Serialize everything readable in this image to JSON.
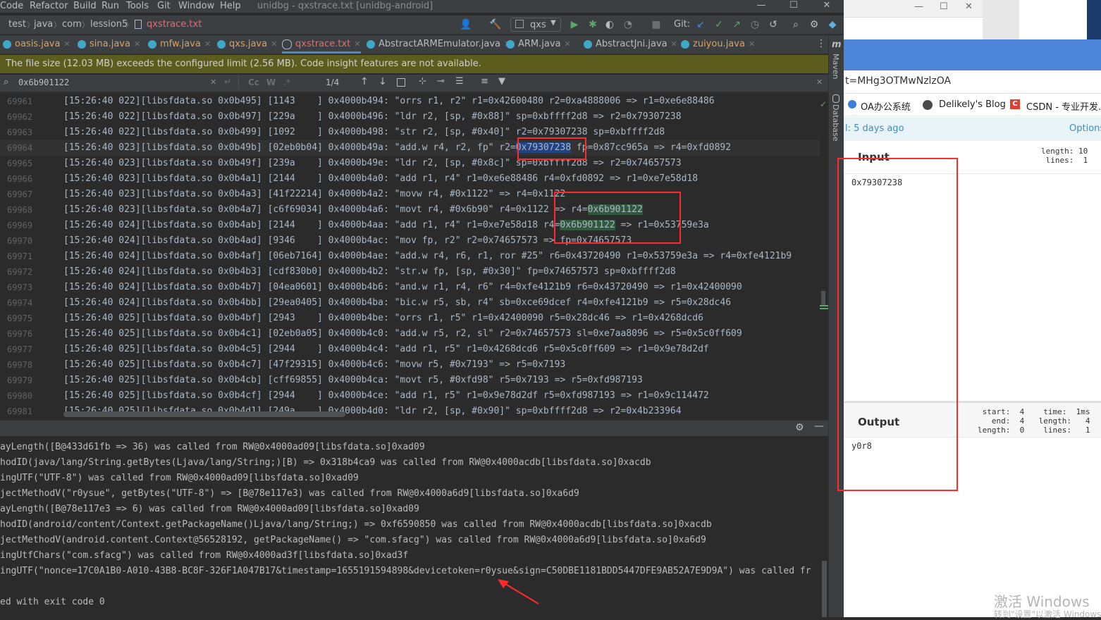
{
  "ide": {
    "menu": [
      "Code",
      "Refactor",
      "Build",
      "Run",
      "Tools",
      "Git",
      "Window",
      "Help"
    ],
    "window_title": "unidbg - qxstrace.txt [unidbg-android]",
    "window_buttons": [
      "—",
      "☐",
      "✕"
    ],
    "breadcrumbs": [
      "test",
      "java",
      "com",
      "lession5",
      "qxstrace.txt"
    ],
    "run_config": "qxs",
    "git_label": "Git:",
    "tabs": [
      {
        "label": "oasis.java",
        "color": "#40a8c7",
        "active": false
      },
      {
        "label": "sina.java",
        "color": "#40a8c7",
        "active": false
      },
      {
        "label": "mfw.java",
        "color": "#40a8c7",
        "active": false
      },
      {
        "label": "qxs.java",
        "color": "#40a8c7",
        "active": false
      },
      {
        "label": "qxstrace.txt",
        "color": "#a9b7c6",
        "active": true
      },
      {
        "label": "AbstractARMEmulator.java",
        "color": "#40a8c7",
        "active": false
      },
      {
        "label": "ARM.java",
        "color": "#40a8c7",
        "active": false
      },
      {
        "label": "AbstractJni.java",
        "color": "#40a8c7",
        "active": false
      },
      {
        "label": "zuiyou.java",
        "color": "#40a8c7",
        "active": false
      }
    ],
    "banner": "The file size (12.03 MB) exceeds the configured limit (2.56 MB). Code insight features are not available.",
    "find": {
      "query": "0x6b901122",
      "count": "1/4",
      "cc": "Cc",
      "w": "W"
    },
    "editor_lines": [
      {
        "num": "69961",
        "text": "[15:26:40 022][libsfdata.so 0x0b495] [1143    ] 0x4000b494: \"orrs r1, r2\" r1=0x42600480 r2=0xa4888006 => r1=0xe6e88486"
      },
      {
        "num": "69962",
        "text": "[15:26:40 022][libsfdata.so 0x0b497] [229a    ] 0x4000b496: \"ldr r2, [sp, #0x88]\" sp=0xbffff2d8 => r2=0x79307238"
      },
      {
        "num": "69963",
        "text": "[15:26:40 022][libsfdata.so 0x0b499] [1092    ] 0x4000b498: \"str r2, [sp, #0x40]\" r2=0x79307238 sp=0xbffff2d8"
      },
      {
        "num": "69964",
        "pre": "[15:26:40 023][libsfdata.so 0x0b49b] [02eb0b04] 0x4000b49a: \"add.w r4, r2, fp\" r2=",
        "sel": "0x79307238",
        "post": " fp=0x87cc965a => r4=0xfd0892"
      },
      {
        "num": "69965",
        "text": "[15:26:40 023][libsfdata.so 0x0b49f] [239a    ] 0x4000b49e: \"ldr r2, [sp, #0x8c]\" sp=0xbffff2d8 => r2=0x74657573"
      },
      {
        "num": "69966",
        "text": "[15:26:40 023][libsfdata.so 0x0b4a1] [2144    ] 0x4000b4a0: \"add r1, r4\" r1=0xe6e88486 r4=0xfd0892 => r1=0xe7e58d18"
      },
      {
        "num": "69967",
        "text": "[15:26:40 023][libsfdata.so 0x0b4a3] [41f22214] 0x4000b4a2: \"movw r4, #0x1122\" => r4=0x1122"
      },
      {
        "num": "69968",
        "pre": "[15:26:40 023][libsfdata.so 0x0b4a7] [c6f69034] 0x4000b4a6: \"movt r4, #0x6b90\" r4=0x1122 => r4=",
        "find": "0x6b901122",
        "post": ""
      },
      {
        "num": "69969",
        "pre": "[15:26:40 024][libsfdata.so 0x0b4ab] [2144    ] 0x4000b4aa: \"add r1, r4\" r1=0xe7e58d18 r4=",
        "find": "0x6b901122",
        "post": " => r1=0x53759e3a"
      },
      {
        "num": "69970",
        "text": "[15:26:40 024][libsfdata.so 0x0b4ad] [9346    ] 0x4000b4ac: \"mov fp, r2\" r2=0x74657573 => fp=0x74657573"
      },
      {
        "num": "69971",
        "text": "[15:26:40 024][libsfdata.so 0x0b4af] [06eb7164] 0x4000b4ae: \"add.w r4, r6, r1, ror #25\" r6=0x43720490 r1=0x53759e3a => r4=0xfe4121b9"
      },
      {
        "num": "69972",
        "text": "[15:26:40 024][libsfdata.so 0x0b4b3] [cdf830b0] 0x4000b4b2: \"str.w fp, [sp, #0x30]\" fp=0x74657573 sp=0xbffff2d8"
      },
      {
        "num": "69973",
        "text": "[15:26:40 024][libsfdata.so 0x0b4b7] [04ea0601] 0x4000b4b6: \"and.w r1, r4, r6\" r4=0xfe4121b9 r6=0x43720490 => r1=0x42400090"
      },
      {
        "num": "69974",
        "text": "[15:26:40 024][libsfdata.so 0x0b4bb] [29ea0405] 0x4000b4ba: \"bic.w r5, sb, r4\" sb=0xce69dcef r4=0xfe4121b9 => r5=0x28dc46"
      },
      {
        "num": "69975",
        "text": "[15:26:40 025][libsfdata.so 0x0b4bf] [2943    ] 0x4000b4be: \"orrs r1, r5\" r1=0x42400090 r5=0x28dc46 => r1=0x4268dcd6"
      },
      {
        "num": "69976",
        "text": "[15:26:40 025][libsfdata.so 0x0b4c1] [02eb0a05] 0x4000b4c0: \"add.w r5, r2, sl\" r2=0x74657573 sl=0xe7aa8096 => r5=0x5c0ff609"
      },
      {
        "num": "69977",
        "text": "[15:26:40 025][libsfdata.so 0x0b4c5] [2944    ] 0x4000b4c4: \"add r1, r5\" r1=0x4268dcd6 r5=0x5c0ff609 => r1=0x9e78d2df"
      },
      {
        "num": "69978",
        "text": "[15:26:40 025][libsfdata.so 0x0b4c7] [47f29315] 0x4000b4c6: \"movw r5, #0x7193\" => r5=0x7193"
      },
      {
        "num": "69979",
        "text": "[15:26:40 025][libsfdata.so 0x0b4cb] [cff69855] 0x4000b4ca: \"movt r5, #0xfd98\" r5=0x7193 => r5=0xfd987193"
      },
      {
        "num": "69980",
        "text": "[15:26:40 025][libsfdata.so 0x0b4cf] [2944    ] 0x4000b4ce: \"add r1, r5\" r1=0x9e78d2df r5=0xfd987193 => r1=0x9c114472"
      },
      {
        "num": "69981",
        "text": "[15:26:40 025][libsfdata.so 0x0b4d1] [249a    ] 0x4000b4d0: \"ldr r2, [sp, #0x90]\" sp=0xbffff2d8 => r2=0x4b233964"
      }
    ],
    "console_lines": [
      "ayLength([B@433d61fb => 36) was called from RW@0x4000ad09[libsfdata.so]0xad09",
      "hodID(java/lang/String.getBytes(Ljava/lang/String;)[B) => 0x318b4ca9 was called from RW@0x4000acdb[libsfdata.so]0xacdb",
      "ingUTF(\"UTF-8\") was called from RW@0x4000ad09[libsfdata.so]0xad09",
      "jectMethodV(\"r0ysue\", getBytes(\"UTF-8\") => [B@78e117e3) was called from RW@0x4000a6d9[libsfdata.so]0xa6d9",
      "ayLength([B@78e117e3 => 6) was called from RW@0x4000ad09[libsfdata.so]0xad09",
      "hodID(android/content/Context.getPackageName()Ljava/lang/String;) => 0xf6590850 was called from RW@0x4000acdb[libsfdata.so]0xacdb",
      "jectMethodV(android.content.Context@56528192, getPackageName() => \"com.sfacg\") was called from RW@0x4000a6d9[libsfdata.so]0xa6d9",
      "ingUtfChars(\"com.sfacg\") was called from RW@0x4000ad3f[libsfdata.so]0xad3f",
      "ingUTF(\"nonce=17C0A1B0-A010-43B8-BC8F-326F1A047B17&timestamp=1655191594898&devicetoken=r0ysue&sign=C50DBE1181BDD5447DFE9AB52A7E9D9A\") was called fr",
      "",
      "ed with exit code 0"
    ],
    "side_tabs": [
      "Maven",
      "Database"
    ]
  },
  "browser": {
    "url": "t=MHg3OTMwNzlzOA",
    "bookmarks": [
      "OA办公系统",
      "Delikely's Blog",
      "CSDN - 专业开发..."
    ],
    "saved": "l: 5 days ago",
    "options": "Options",
    "input": {
      "title": "Input",
      "stats": "length: 10\n lines:  1",
      "text": "0x79307238"
    },
    "output": {
      "title": "Output",
      "stats_left": "start:  4\n  end:  4\nlength:  0",
      "stats_right": "  time:  1ms\nlength:   4\n lines:   1",
      "text": "y0r8"
    },
    "watermark": "激活 Windows",
    "watermark2": "转到\"设置\"以激活 Windows。"
  }
}
